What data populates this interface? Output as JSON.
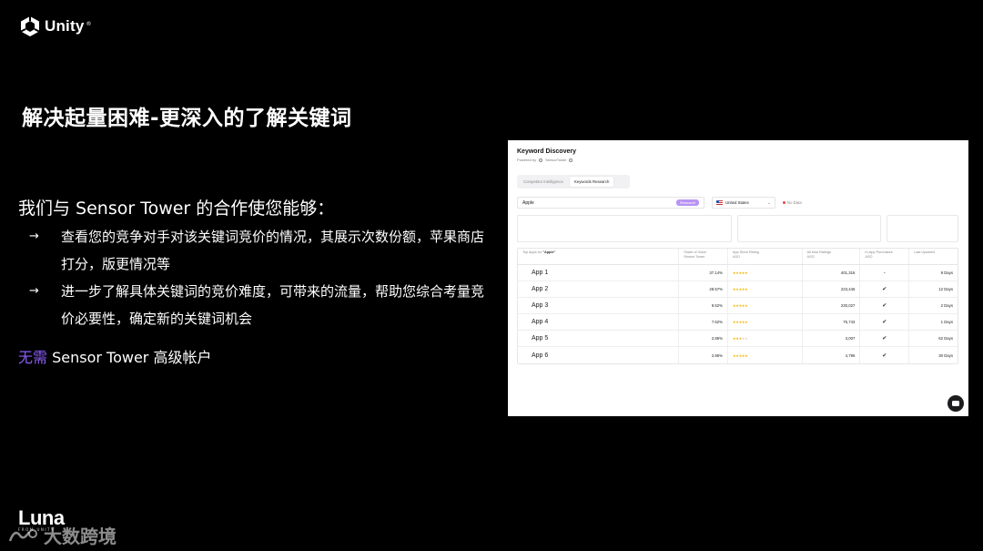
{
  "brand": {
    "name": "Unity",
    "reg": "®"
  },
  "title": "解决起量困难-更深入的了解关键词",
  "intro": "我们与 Sensor Tower 的合作使您能够：",
  "bullets": [
    {
      "arrow": "→",
      "text": "查看您的竞争对手对该关键词竞价的情况，其展示次数份额，苹果商店打分，版更情况等"
    },
    {
      "arrow": "→",
      "text": "进一步了解具体关键词的竞价难度，可带来的流量，帮助您综合考量竞价必要性，确定新的关键词机会"
    }
  ],
  "note": {
    "accent": "无需",
    "rest": " Sensor Tower 高级帐户",
    "accent_color": "#8a5cf5"
  },
  "footer": {
    "logo": "Luna",
    "logo_sub": "FROM UNITY",
    "watermark": "大数跨境"
  },
  "screenshot": {
    "title": "Keyword Discovery",
    "powered_by": "Powered by",
    "powered_name": "SensorTower",
    "tabs": [
      "Competitor Intelligence",
      "Keywords Research"
    ],
    "active_tab": 1,
    "search_value": "Apple",
    "search_button": "Research",
    "country": "United States",
    "no_data": "No Data",
    "columns": [
      {
        "label": "Top Apps for ",
        "bold": "\"Apple\"",
        "sub": ""
      },
      {
        "label": "Share of Voice",
        "sub": "Sensor Tower"
      },
      {
        "label": "App Store Rating",
        "sub": "ASO"
      },
      {
        "label": "All time Ratings",
        "sub": "ASO"
      },
      {
        "label": "In-App Purchases",
        "sub": "ASO"
      },
      {
        "label": "Last Updated",
        "sub": ""
      }
    ],
    "rows": [
      {
        "app": "App 1",
        "share": "37.14%",
        "rating": 5,
        "ratings_count": "401,316",
        "iap": "-",
        "updated": "9 Days"
      },
      {
        "app": "App 2",
        "share": "28.57%",
        "rating": 5,
        "ratings_count": "223,446",
        "iap": "✔",
        "updated": "12 Days"
      },
      {
        "app": "App 3",
        "share": "9.52%",
        "rating": 5,
        "ratings_count": "230,027",
        "iap": "✔",
        "updated": "2 Days"
      },
      {
        "app": "App 4",
        "share": "7.62%",
        "rating": 5,
        "ratings_count": "75,743",
        "iap": "✔",
        "updated": "1 Days"
      },
      {
        "app": "App 5",
        "share": "2.86%",
        "rating": 3,
        "ratings_count": "3,007",
        "iap": "✔",
        "updated": "62 Days"
      },
      {
        "app": "App 6",
        "share": "2.86%",
        "rating": 5,
        "ratings_count": "4,796",
        "iap": "✔",
        "updated": "30 Days"
      }
    ]
  }
}
